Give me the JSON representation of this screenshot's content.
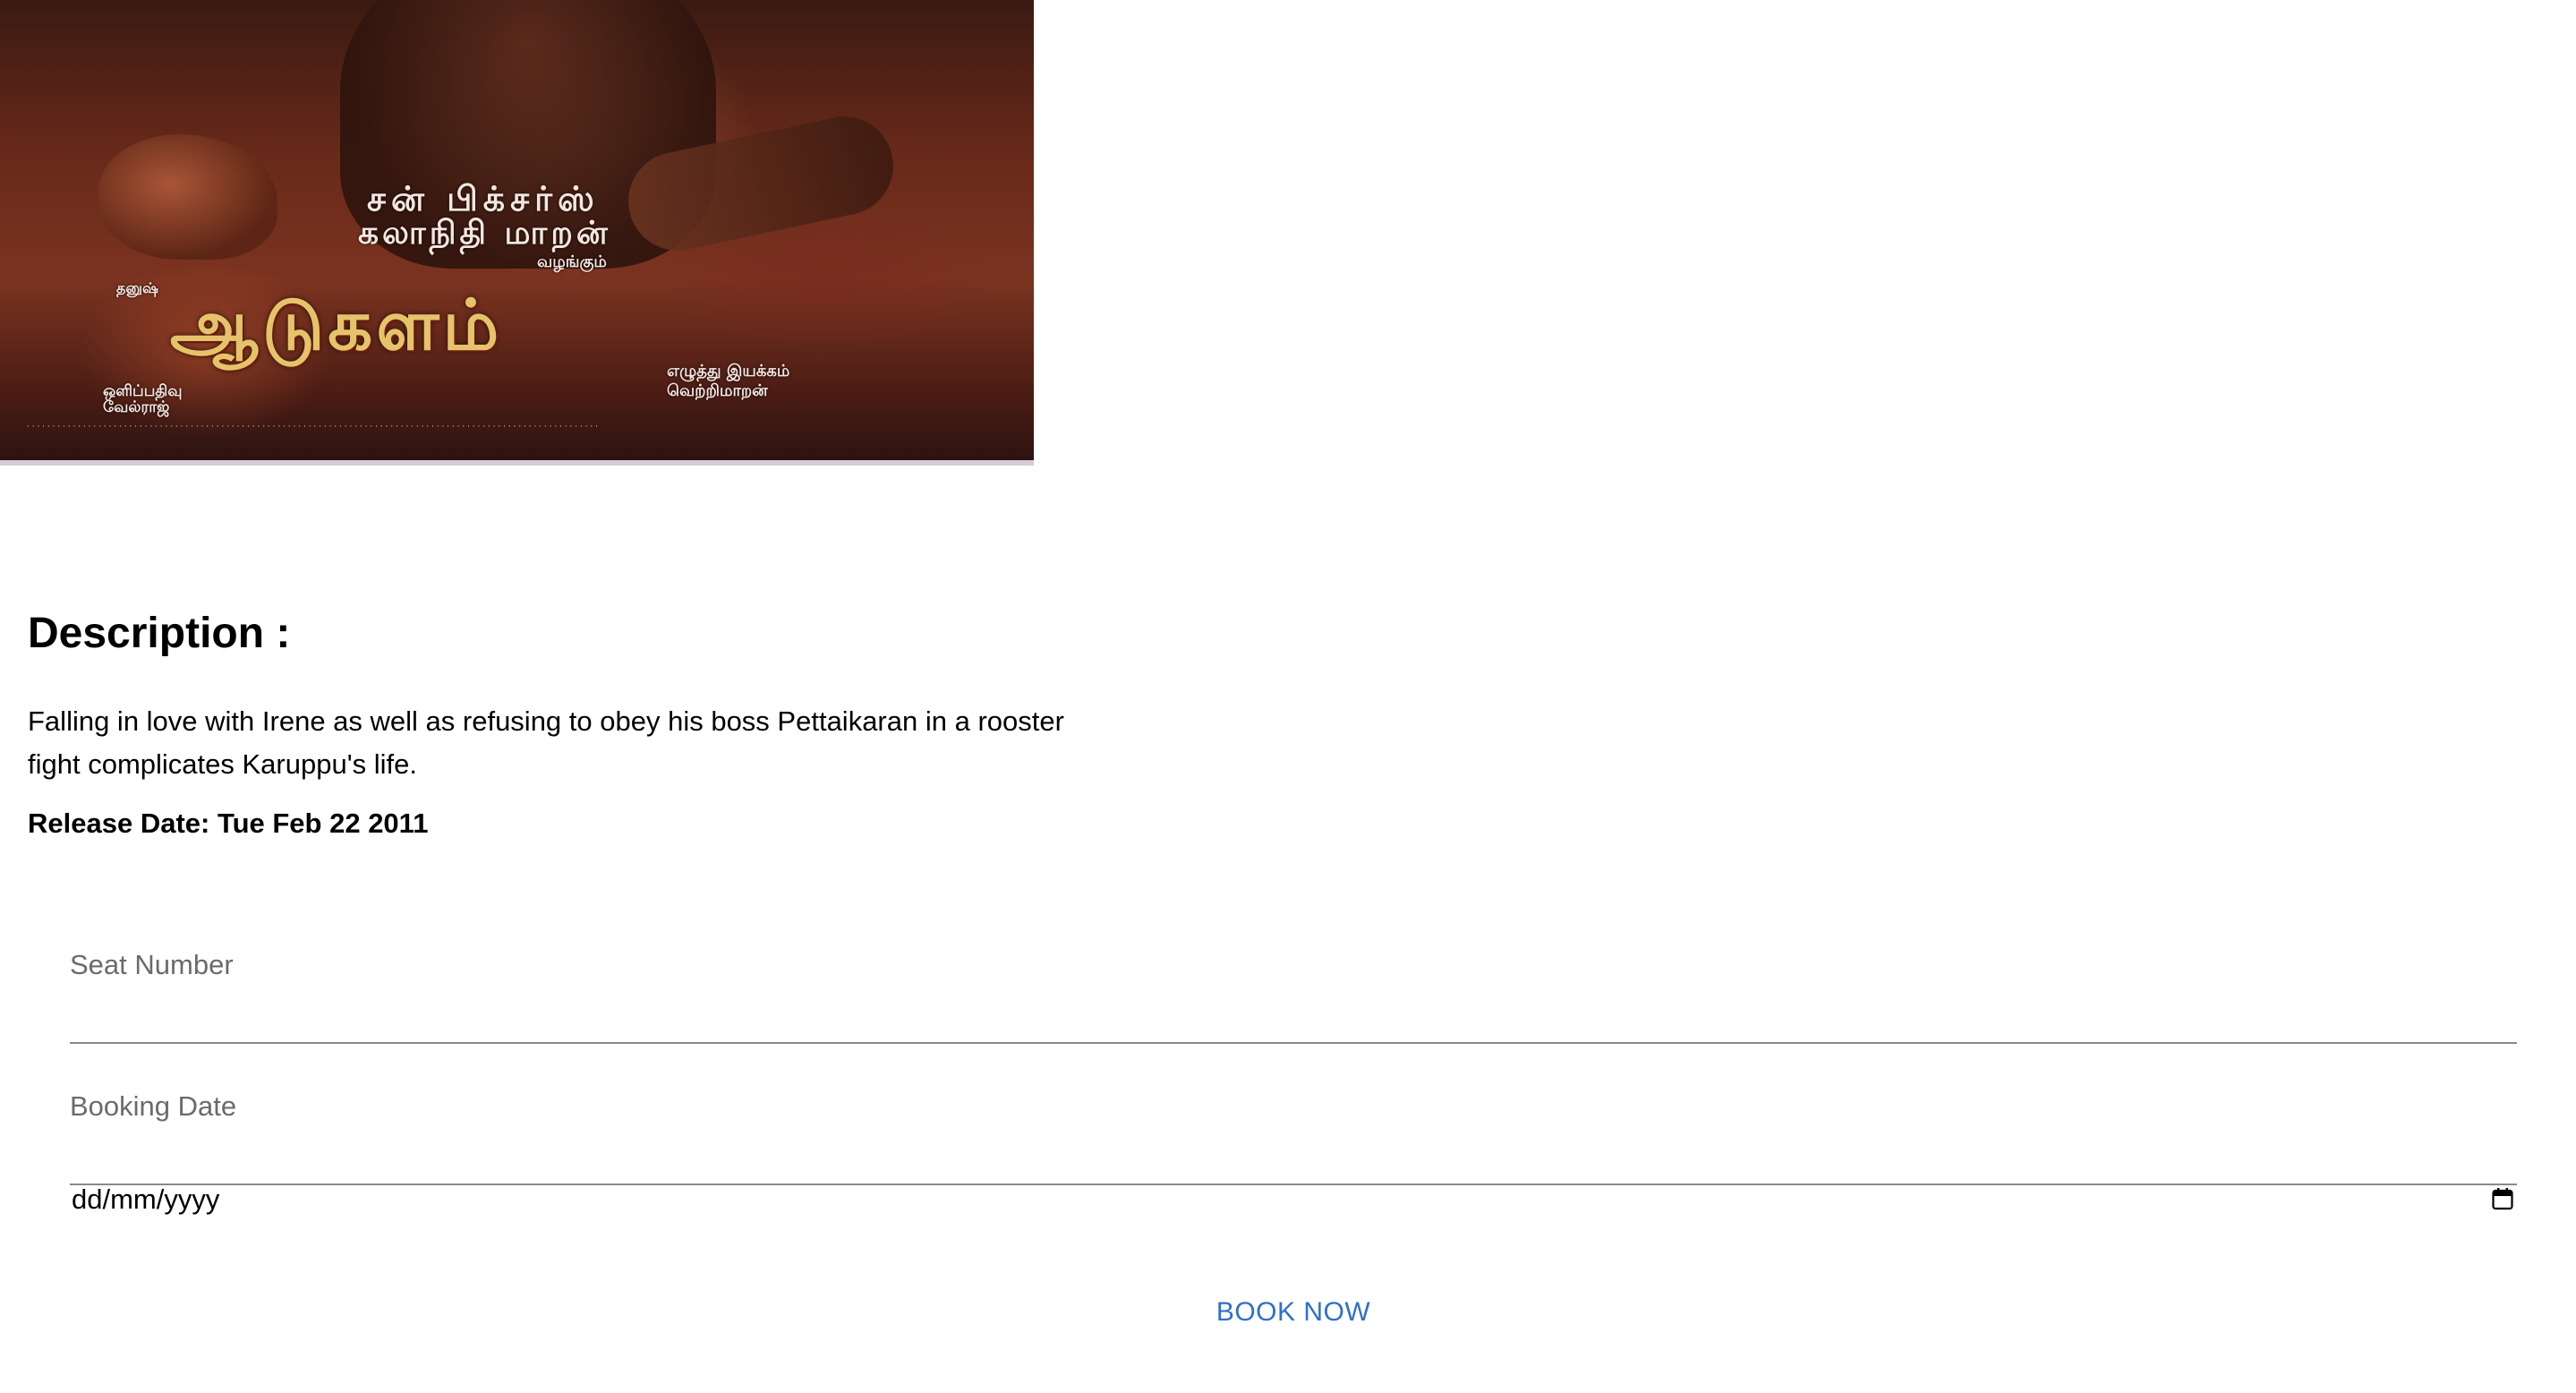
{
  "poster": {
    "alt": "Movie poster",
    "line1": "சன் பிக்சர்ஸ்",
    "line2": "கலாநிதி மாறன்",
    "line3": "வழங்கும்",
    "small_left": "தனுஷ்",
    "title_art": "ஆடுகளம்",
    "credit_left_1": "ஒளிப்பதிவு",
    "credit_left_2": "வேல்ராஜ்",
    "credit_right_1": "எழுத்து இயக்கம்",
    "credit_right_2": "வெற்றிமாறன்",
    "fine_print": "· · · · · · · · · · · · · · · · · · · · · · · · · · · · · · · · · · · · · · · · · · · · · · · · · · · · · · · · · · · · · · · · · · · · · · · · · · · · · · · · · · · · · · · · · · · · · · · · · · · · · · · · · · · · · · · ·"
  },
  "description": {
    "heading": "Description :",
    "text": "Falling in love with Irene as well as refusing to obey his boss Pettaikaran in a rooster fight complicates Karuppu's life.",
    "release": "Release Date: Tue Feb 22 2011"
  },
  "form": {
    "seat_label": "Seat Number",
    "seat_value": "",
    "booking_label": "Booking Date",
    "booking_value": "dd/mm/yyyy",
    "submit_label": "BOOK NOW"
  },
  "icons": {
    "calendar": "calendar-icon"
  },
  "colors": {
    "accent": "#2f6fca",
    "label": "#6b6b6b",
    "underline": "#8a8a8a"
  }
}
